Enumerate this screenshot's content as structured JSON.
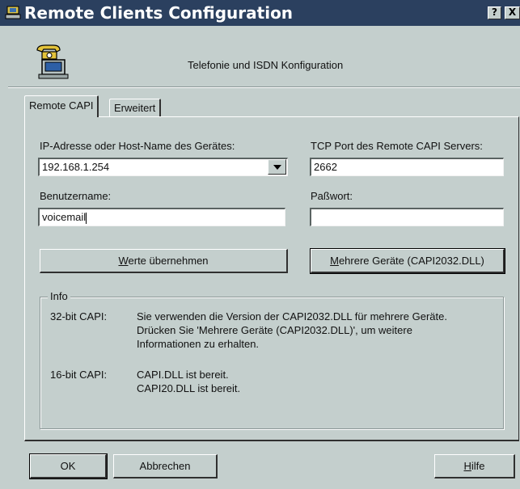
{
  "window": {
    "title": "Remote Clients Configuration",
    "help_glyph": "?",
    "close_glyph": "X"
  },
  "header": {
    "icon": "telephone-computer-icon",
    "text": "Telefonie und ISDN Konfiguration"
  },
  "tabs": [
    {
      "label": "Remote CAPI",
      "selected": true
    },
    {
      "label": "Erweitert",
      "selected": false
    }
  ],
  "form": {
    "ip_label": "IP-Adresse oder Host-Name des Gerätes:",
    "ip_value": "192.168.1.254",
    "port_label": "TCP Port des Remote CAPI Servers:",
    "port_value": "2662",
    "user_label": "Benutzername:",
    "user_value": "voicemail",
    "pass_label": "Paßwort:",
    "pass_value": ""
  },
  "buttons": {
    "apply_mnemonic": "W",
    "apply_rest": "erte übernehmen",
    "multi_mnemonic": "M",
    "multi_rest": "ehrere Geräte (CAPI2032.DLL)",
    "ok": "OK",
    "cancel": "Abbrechen",
    "help_mnemonic": "H",
    "help_rest": "ilfe"
  },
  "info": {
    "legend": "Info",
    "rows": [
      {
        "label": "32-bit CAPI:",
        "lines": [
          "Sie verwenden die Version der CAPI2032.DLL für mehrere Geräte.",
          "Drücken Sie 'Mehrere Geräte (CAPI2032.DLL)', um weitere",
          "Informationen zu erhalten."
        ]
      },
      {
        "label": "16-bit CAPI:",
        "lines": [
          "CAPI.DLL ist bereit.",
          "CAPI20.DLL ist bereit."
        ]
      }
    ]
  },
  "colors": {
    "titlebar": "#2b405f",
    "dialog": "#c4cfcd"
  }
}
